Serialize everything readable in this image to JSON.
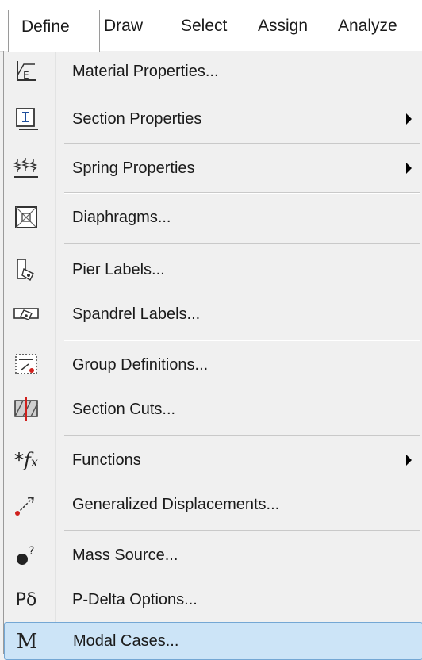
{
  "menubar": {
    "items": [
      {
        "label": "Define"
      },
      {
        "label": "Draw"
      },
      {
        "label": "Select"
      },
      {
        "label": "Assign"
      },
      {
        "label": "Analyze"
      }
    ]
  },
  "dropdown": {
    "items": [
      {
        "label": "Material Properties...",
        "icon": "material-properties-icon"
      },
      {
        "label": "Section Properties",
        "icon": "section-properties-icon",
        "submenu": true
      },
      {
        "label": "Spring Properties",
        "icon": "spring-properties-icon",
        "submenu": true
      },
      {
        "label": "Diaphragms...",
        "icon": "diaphragms-icon"
      },
      {
        "label": "Pier Labels...",
        "icon": "pier-labels-icon"
      },
      {
        "label": "Spandrel Labels...",
        "icon": "spandrel-labels-icon"
      },
      {
        "label": "Group Definitions...",
        "icon": "group-definitions-icon"
      },
      {
        "label": "Section Cuts...",
        "icon": "section-cuts-icon"
      },
      {
        "label": "Functions",
        "icon": "functions-icon",
        "submenu": true
      },
      {
        "label": "Generalized Displacements...",
        "icon": "generalized-displacements-icon"
      },
      {
        "label": "Mass Source...",
        "icon": "mass-source-icon"
      },
      {
        "label": "P-Delta Options...",
        "icon": "p-delta-icon",
        "icon_text": "Pδ"
      },
      {
        "label": "Modal Cases...",
        "icon": "modal-cases-icon",
        "icon_text": "M",
        "highlighted": true
      }
    ]
  },
  "colors": {
    "highlight_bg": "#cce4f7",
    "highlight_border": "#74a7d4",
    "accent_red": "#d0201c",
    "icon_blue": "#1f4e9c"
  }
}
